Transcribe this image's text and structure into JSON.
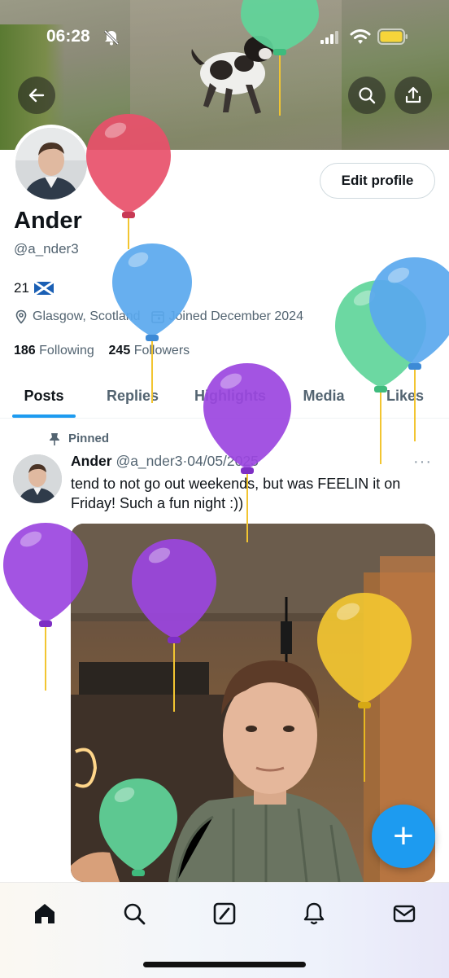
{
  "status_bar": {
    "time": "06:28"
  },
  "profile": {
    "name": "Ander",
    "handle": "@a_nder3",
    "bio": "21",
    "location": "Glasgow, Scotland",
    "joined": "Joined December 2024",
    "following_count": "186",
    "following_label": "Following",
    "followers_count": "245",
    "followers_label": "Followers",
    "edit_button": "Edit profile"
  },
  "tabs": [
    {
      "label": "Posts"
    },
    {
      "label": "Replies"
    },
    {
      "label": "Highlights"
    },
    {
      "label": "Media"
    },
    {
      "label": "Likes"
    }
  ],
  "post": {
    "pinned_label": "Pinned",
    "author": "Ander",
    "handle": "@a_nder3",
    "separator": "·",
    "date": "04/05/2025",
    "more": "···",
    "text": "tend to not go out weekends, but was FEELIN it on Friday! Such a fun night :))"
  },
  "fab_label": "+",
  "nav_icons": [
    "home-icon",
    "search-icon",
    "grok-icon",
    "notifications-icon",
    "messages-icon"
  ],
  "colors": {
    "accent": "#1d9bf0",
    "balloon_red": "#e8506a",
    "balloon_blue": "#5aa8ee",
    "balloon_green": "#5fd59a",
    "balloon_purple": "#9b45e0",
    "balloon_yellow": "#f2c531"
  }
}
